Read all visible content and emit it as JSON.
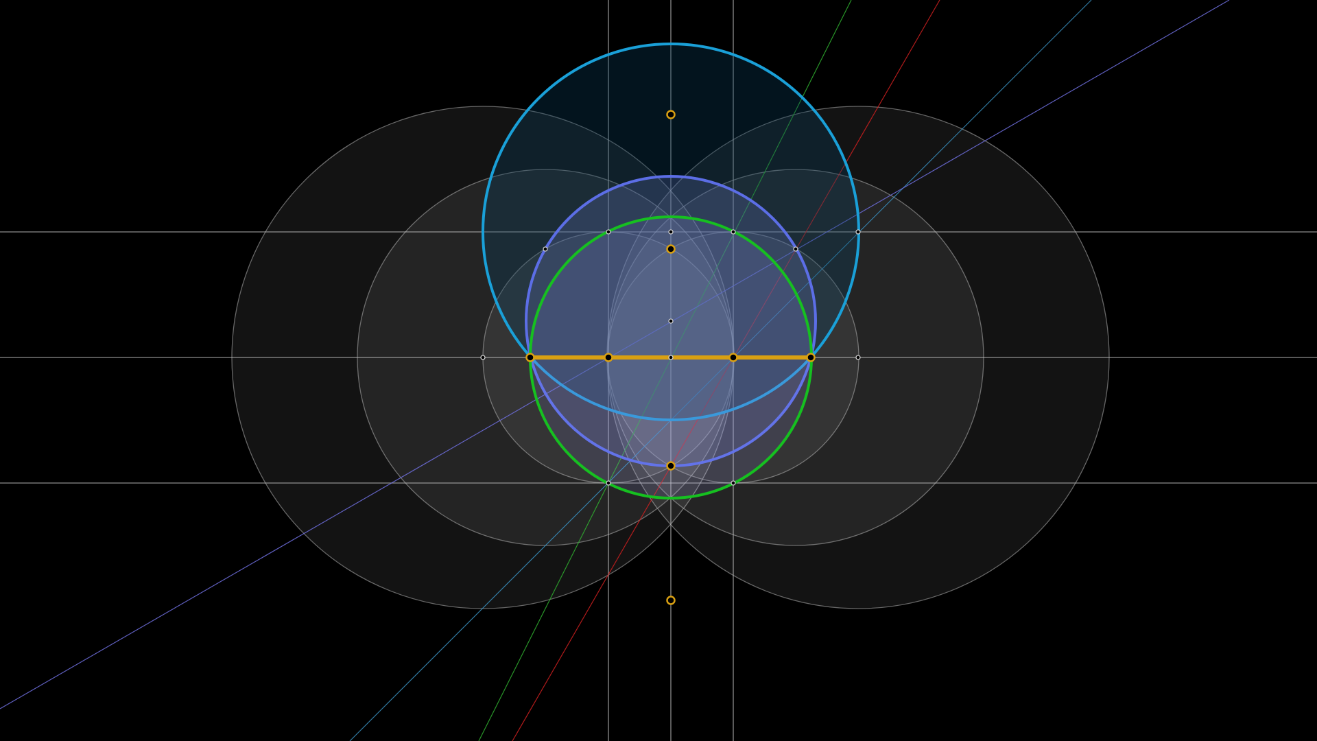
{
  "diagram": {
    "background": "#000000",
    "colors": {
      "gray_circle_fill": "#ffffff",
      "gray_stroke": "#b4b4b4",
      "gray_line": "#c8c8c8",
      "cyan": "#1aa0d8",
      "cyan_fill": "#0a3d5c",
      "violet": "#5c6ee6",
      "violet_fill": "#7080d0",
      "green": "#16c020",
      "green_fill": "#a0a0ff",
      "gold": "#d9a012",
      "red_line": "#d02020",
      "green_line": "#30b030",
      "blue_line": "#3a90c0",
      "violet_line": "#7070e0"
    }
  }
}
